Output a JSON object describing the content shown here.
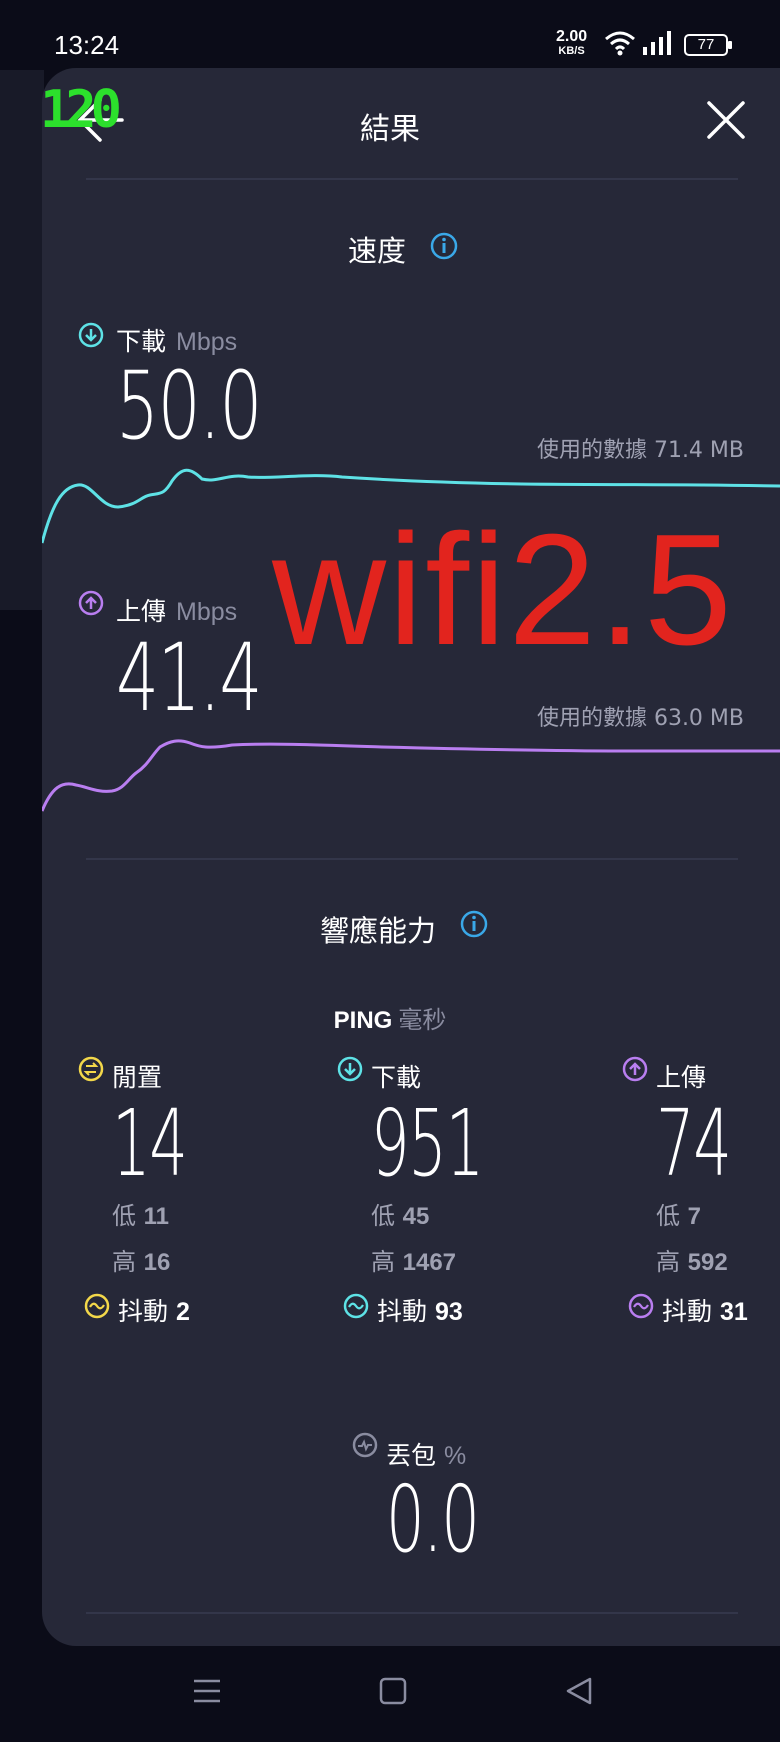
{
  "status_bar": {
    "time": "13:24",
    "net_speed": "2.00",
    "net_unit": "KB/S",
    "battery": "77"
  },
  "overlay": {
    "fps": "120",
    "watermark": "wifi2.5",
    "watermark_color": "#e2241e"
  },
  "header": {
    "title": "結果"
  },
  "speed": {
    "title": "速度",
    "download": {
      "label": "下載",
      "unit": "Mbps",
      "value": "50.0",
      "used_label": "使用的數據 71.4 MB",
      "color": "#5ee2e6"
    },
    "upload": {
      "label": "上傳",
      "unit": "Mbps",
      "value": "41.4",
      "used_label": "使用的數據 63.0 MB",
      "color": "#b97ef0"
    }
  },
  "responsiveness": {
    "title": "響應能力",
    "ping_label": "PING",
    "ping_unit": "毫秒",
    "idle": {
      "label": "閒置",
      "value": "14",
      "low_label": "低",
      "low": "11",
      "high_label": "高",
      "high": "16",
      "jitter_label": "抖動",
      "jitter": "2",
      "color": "#f3d84a"
    },
    "download": {
      "label": "下載",
      "value": "951",
      "low_label": "低",
      "low": "45",
      "high_label": "高",
      "high": "1467",
      "jitter_label": "抖動",
      "jitter": "93",
      "color": "#5ee2e6"
    },
    "upload": {
      "label": "上傳",
      "value": "74",
      "low_label": "低",
      "low": "7",
      "high_label": "高",
      "high": "592",
      "jitter_label": "抖動",
      "jitter": "31",
      "color": "#b97ef0"
    },
    "packet_loss": {
      "label": "丟包",
      "unit": "%",
      "value": "0.0"
    }
  }
}
